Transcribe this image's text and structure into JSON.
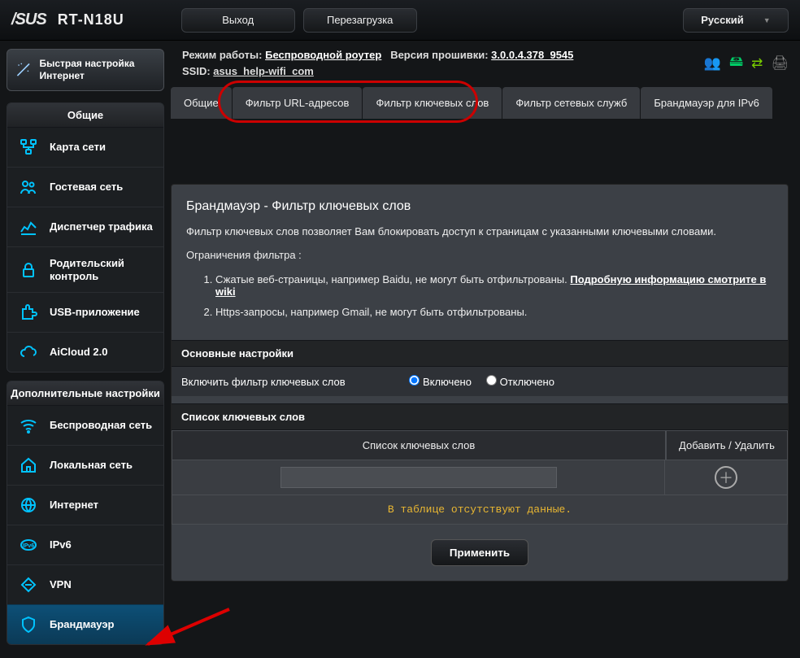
{
  "top": {
    "brand": "/SUS",
    "model": "RT-N18U",
    "btn_logout": "Выход",
    "btn_reboot": "Перезагрузка",
    "lang": "Русский"
  },
  "info": {
    "mode_label": "Режим работы:",
    "mode_value": "Беспроводной роутер",
    "fw_label": "Версия прошивки:",
    "fw_value": "3.0.0.4.378_9545",
    "ssid_label": "SSID:",
    "ssid_value": "asus_help-wifi_com"
  },
  "sidebar": {
    "qis": "Быстрая настройка Интернет",
    "section_general": "Общие",
    "section_advanced": "Дополнительные настройки",
    "general": [
      {
        "label": "Карта сети"
      },
      {
        "label": "Гостевая сеть"
      },
      {
        "label": "Диспетчер трафика"
      },
      {
        "label": "Родительский контроль"
      },
      {
        "label": "USB-приложение"
      },
      {
        "label": "AiCloud 2.0"
      }
    ],
    "advanced": [
      {
        "label": "Беспроводная сеть"
      },
      {
        "label": "Локальная сеть"
      },
      {
        "label": "Интернет"
      },
      {
        "label": "IPv6"
      },
      {
        "label": "VPN"
      },
      {
        "label": "Брандмауэр"
      }
    ]
  },
  "tabs": {
    "t0": "Общие",
    "t1": "Фильтр URL-адресов",
    "t2": "Фильтр ключевых слов",
    "t3": "Фильтр сетевых служб",
    "t4": "Брандмауэр для IPv6"
  },
  "panel": {
    "title": "Брандмауэр - Фильтр ключевых слов",
    "desc": "Фильтр ключевых слов позволяет Вам блокировать доступ к страницам с указанными ключевыми словами.",
    "limits_label": "Ограничения фильтра :",
    "li1_a": "Сжатые веб-страницы, например Baidu, не могут быть отфильтрованы. ",
    "li1_link": "Подробную информацию смотрите в wiki",
    "li2": "Https-запросы, например Gmail, не могут быть отфильтрованы.",
    "section_basic": "Основные настройки",
    "enable_label": "Включить фильтр ключевых слов",
    "opt_on": "Включено",
    "opt_off": "Отключено",
    "section_list": "Список ключевых слов",
    "th_col1": "Список ключевых слов",
    "th_col2": "Добавить / Удалить",
    "empty": "В таблице отсутствуют данные.",
    "apply": "Применить"
  }
}
